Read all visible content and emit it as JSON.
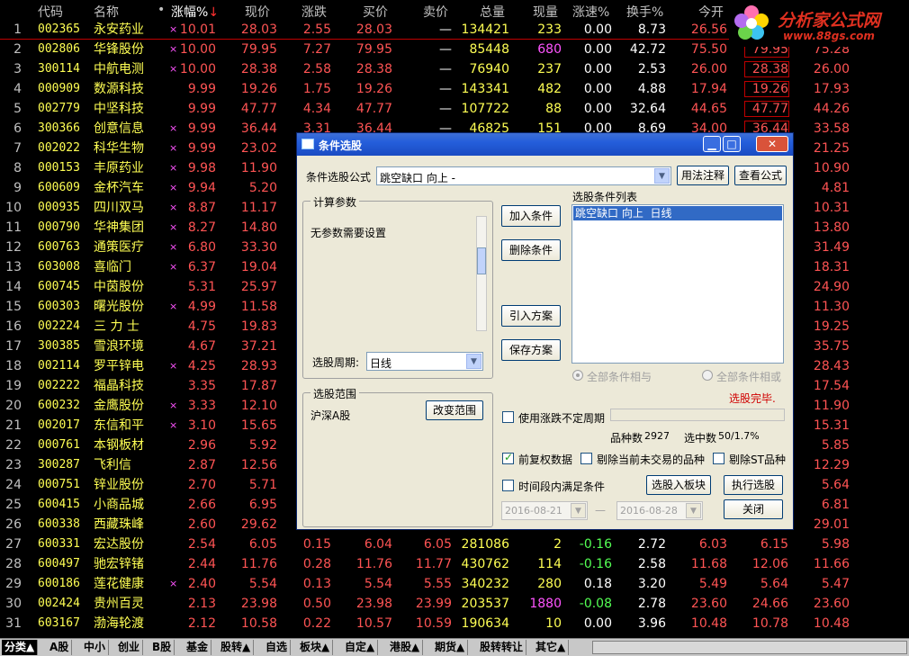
{
  "header": {
    "cols": [
      "代码",
      "名称",
      "•",
      "涨幅%",
      "现价",
      "涨跌",
      "买价",
      "卖价",
      "总量",
      "现量",
      "涨速%",
      "换手%",
      "今开"
    ],
    "sort_indicator": "↓"
  },
  "logo": {
    "title": "分析家公式网",
    "url": "www.88gs.com"
  },
  "rows": [
    {
      "i": "1",
      "code": "002365",
      "name": "永安药业",
      "star": "×",
      "pct": "10.01",
      "price": "28.03",
      "chg": "2.55",
      "buy": "28.03",
      "sell": "—",
      "vol": "134421",
      "cur": "233",
      "spd": "0.00",
      "turn": "8.73",
      "open": "26.56",
      "high": "",
      "low": ""
    },
    {
      "i": "2",
      "code": "002806",
      "name": "华锋股份",
      "star": "×",
      "pct": "10.00",
      "price": "79.95",
      "chg": "7.27",
      "buy": "79.95",
      "sell": "—",
      "vol": "85448",
      "cur": "680",
      "spd": "0.00",
      "turn": "42.72",
      "open": "75.50",
      "high": "79.95",
      "low": "75.28"
    },
    {
      "i": "3",
      "code": "300114",
      "name": "中航电测",
      "star": "×",
      "pct": "10.00",
      "price": "28.38",
      "chg": "2.58",
      "buy": "28.38",
      "sell": "—",
      "vol": "76940",
      "cur": "237",
      "spd": "0.00",
      "turn": "2.53",
      "open": "26.00",
      "high": "28.38",
      "low": "26.00"
    },
    {
      "i": "4",
      "code": "000909",
      "name": "数源科技",
      "star": "",
      "pct": "9.99",
      "price": "19.26",
      "chg": "1.75",
      "buy": "19.26",
      "sell": "—",
      "vol": "143341",
      "cur": "482",
      "spd": "0.00",
      "turn": "4.88",
      "open": "17.94",
      "high": "19.26",
      "low": "17.93"
    },
    {
      "i": "5",
      "code": "002779",
      "name": "中坚科技",
      "star": "",
      "pct": "9.99",
      "price": "47.77",
      "chg": "4.34",
      "buy": "47.77",
      "sell": "—",
      "vol": "107722",
      "cur": "88",
      "spd": "0.00",
      "turn": "32.64",
      "open": "44.65",
      "high": "47.77",
      "low": "44.26"
    },
    {
      "i": "6",
      "code": "300366",
      "name": "创意信息",
      "star": "×",
      "pct": "9.99",
      "price": "36.44",
      "chg": "3.31",
      "buy": "36.44",
      "sell": "—",
      "vol": "46825",
      "cur": "151",
      "spd": "0.00",
      "turn": "8.69",
      "open": "34.00",
      "high": "36.44",
      "low": "33.58"
    },
    {
      "i": "7",
      "code": "002022",
      "name": "科华生物",
      "star": "×",
      "pct": "9.99",
      "price": "23.02",
      "chg": "",
      "buy": "",
      "sell": "",
      "vol": "",
      "cur": "",
      "spd": "",
      "turn": "",
      "open": "",
      "high": "",
      "low": "21.25"
    },
    {
      "i": "8",
      "code": "000153",
      "name": "丰原药业",
      "star": "×",
      "pct": "9.98",
      "price": "11.90",
      "chg": "",
      "buy": "",
      "sell": "",
      "vol": "",
      "cur": "",
      "spd": "",
      "turn": "",
      "open": "",
      "high": "",
      "low": "10.90"
    },
    {
      "i": "9",
      "code": "600609",
      "name": "金杯汽车",
      "star": "×",
      "pct": "9.94",
      "price": "5.20",
      "chg": "",
      "buy": "",
      "sell": "",
      "vol": "",
      "cur": "",
      "spd": "",
      "turn": "",
      "open": "",
      "high": "",
      "low": "4.81"
    },
    {
      "i": "10",
      "code": "000935",
      "name": "四川双马",
      "star": "×",
      "pct": "8.87",
      "price": "11.17",
      "chg": "",
      "buy": "",
      "sell": "",
      "vol": "",
      "cur": "",
      "spd": "",
      "turn": "",
      "open": "",
      "high": "",
      "low": "10.31"
    },
    {
      "i": "11",
      "code": "000790",
      "name": "华神集团",
      "star": "×",
      "pct": "8.27",
      "price": "14.80",
      "chg": "",
      "buy": "",
      "sell": "",
      "vol": "",
      "cur": "",
      "spd": "",
      "turn": "",
      "open": "",
      "high": "",
      "low": "13.80"
    },
    {
      "i": "12",
      "code": "600763",
      "name": "通策医疗",
      "star": "×",
      "pct": "6.80",
      "price": "33.30",
      "chg": "",
      "buy": "",
      "sell": "",
      "vol": "",
      "cur": "",
      "spd": "",
      "turn": "",
      "open": "",
      "high": "",
      "low": "31.49"
    },
    {
      "i": "13",
      "code": "603008",
      "name": "喜临门",
      "star": "×",
      "pct": "6.37",
      "price": "19.04",
      "chg": "",
      "buy": "",
      "sell": "",
      "vol": "",
      "cur": "",
      "spd": "",
      "turn": "",
      "open": "",
      "high": "",
      "low": "18.31"
    },
    {
      "i": "14",
      "code": "600745",
      "name": "中茵股份",
      "star": "",
      "pct": "5.31",
      "price": "25.97",
      "chg": "",
      "buy": "",
      "sell": "",
      "vol": "",
      "cur": "",
      "spd": "",
      "turn": "",
      "open": "",
      "high": "",
      "low": "24.90"
    },
    {
      "i": "15",
      "code": "600303",
      "name": "曙光股份",
      "star": "×",
      "pct": "4.99",
      "price": "11.58",
      "chg": "",
      "buy": "",
      "sell": "",
      "vol": "",
      "cur": "",
      "spd": "",
      "turn": "",
      "open": "",
      "high": "",
      "low": "11.30"
    },
    {
      "i": "16",
      "code": "002224",
      "name": "三 力 士",
      "star": "",
      "pct": "4.75",
      "price": "19.83",
      "chg": "",
      "buy": "",
      "sell": "",
      "vol": "",
      "cur": "",
      "spd": "",
      "turn": "",
      "open": "",
      "high": "",
      "low": "19.25"
    },
    {
      "i": "17",
      "code": "300385",
      "name": "雪浪环境",
      "star": "",
      "pct": "4.67",
      "price": "37.21",
      "chg": "",
      "buy": "",
      "sell": "",
      "vol": "",
      "cur": "",
      "spd": "",
      "turn": "",
      "open": "",
      "high": "",
      "low": "35.75"
    },
    {
      "i": "18",
      "code": "002114",
      "name": "罗平锌电",
      "star": "×",
      "pct": "4.25",
      "price": "28.93",
      "chg": "",
      "buy": "",
      "sell": "",
      "vol": "",
      "cur": "",
      "spd": "",
      "turn": "",
      "open": "",
      "high": "",
      "low": "28.43"
    },
    {
      "i": "19",
      "code": "002222",
      "name": "福晶科技",
      "star": "",
      "pct": "3.35",
      "price": "17.87",
      "chg": "",
      "buy": "",
      "sell": "",
      "vol": "",
      "cur": "",
      "spd": "",
      "turn": "",
      "open": "",
      "high": "",
      "low": "17.54"
    },
    {
      "i": "20",
      "code": "600232",
      "name": "金鹰股份",
      "star": "×",
      "pct": "3.33",
      "price": "12.10",
      "chg": "",
      "buy": "",
      "sell": "",
      "vol": "",
      "cur": "",
      "spd": "",
      "turn": "",
      "open": "",
      "high": "",
      "low": "11.90"
    },
    {
      "i": "21",
      "code": "002017",
      "name": "东信和平",
      "star": "×",
      "pct": "3.10",
      "price": "15.65",
      "chg": "",
      "buy": "",
      "sell": "",
      "vol": "",
      "cur": "",
      "spd": "",
      "turn": "",
      "open": "",
      "high": "",
      "low": "15.31"
    },
    {
      "i": "22",
      "code": "000761",
      "name": "本钢板材",
      "star": "",
      "pct": "2.96",
      "price": "5.92",
      "chg": "",
      "buy": "",
      "sell": "",
      "vol": "",
      "cur": "",
      "spd": "",
      "turn": "",
      "open": "",
      "high": "",
      "low": "5.85"
    },
    {
      "i": "23",
      "code": "300287",
      "name": "飞利信",
      "star": "",
      "pct": "2.87",
      "price": "12.56",
      "chg": "",
      "buy": "",
      "sell": "",
      "vol": "",
      "cur": "",
      "spd": "",
      "turn": "",
      "open": "",
      "high": "",
      "low": "12.29"
    },
    {
      "i": "24",
      "code": "000751",
      "name": "锌业股份",
      "star": "",
      "pct": "2.70",
      "price": "5.71",
      "chg": "",
      "buy": "",
      "sell": "",
      "vol": "",
      "cur": "",
      "spd": "",
      "turn": "",
      "open": "",
      "high": "",
      "low": "5.64"
    },
    {
      "i": "25",
      "code": "600415",
      "name": "小商品城",
      "star": "",
      "pct": "2.66",
      "price": "6.95",
      "chg": "",
      "buy": "",
      "sell": "",
      "vol": "",
      "cur": "",
      "spd": "",
      "turn": "",
      "open": "",
      "high": "",
      "low": "6.81"
    },
    {
      "i": "26",
      "code": "600338",
      "name": "西藏珠峰",
      "star": "",
      "pct": "2.60",
      "price": "29.62",
      "chg": "",
      "buy": "",
      "sell": "",
      "vol": "",
      "cur": "",
      "spd": "",
      "turn": "",
      "open": "",
      "high": "",
      "low": "29.01"
    },
    {
      "i": "27",
      "code": "600331",
      "name": "宏达股份",
      "star": "",
      "pct": "2.54",
      "price": "6.05",
      "chg": "0.15",
      "buy": "6.04",
      "sell": "6.05",
      "vol": "281086",
      "cur": "2",
      "spd": "-0.16",
      "turn": "2.72",
      "open": "6.03",
      "high": "6.15",
      "low": "5.98"
    },
    {
      "i": "28",
      "code": "600497",
      "name": "驰宏锌锗",
      "star": "",
      "pct": "2.44",
      "price": "11.76",
      "chg": "0.28",
      "buy": "11.76",
      "sell": "11.77",
      "vol": "430762",
      "cur": "114",
      "spd": "-0.16",
      "turn": "2.58",
      "open": "11.68",
      "high": "12.06",
      "low": "11.66"
    },
    {
      "i": "29",
      "code": "600186",
      "name": "莲花健康",
      "star": "×",
      "pct": "2.40",
      "price": "5.54",
      "chg": "0.13",
      "buy": "5.54",
      "sell": "5.55",
      "vol": "340232",
      "cur": "280",
      "spd": "0.18",
      "turn": "3.20",
      "open": "5.49",
      "high": "5.64",
      "low": "5.47"
    },
    {
      "i": "30",
      "code": "002424",
      "name": "贵州百灵",
      "star": "",
      "pct": "2.13",
      "price": "23.98",
      "chg": "0.50",
      "buy": "23.98",
      "sell": "23.99",
      "vol": "203537",
      "cur": "1880",
      "spd": "-0.08",
      "turn": "2.78",
      "open": "23.60",
      "high": "24.66",
      "low": "23.60"
    },
    {
      "i": "31",
      "code": "603167",
      "name": "渤海轮渡",
      "star": "",
      "pct": "2.12",
      "price": "10.58",
      "chg": "0.22",
      "buy": "10.57",
      "sell": "10.59",
      "vol": "190634",
      "cur": "10",
      "spd": "0.00",
      "turn": "3.96",
      "open": "10.48",
      "high": "10.78",
      "low": "10.48"
    }
  ],
  "tabs": [
    "分类▲",
    "A股",
    "中小",
    "创业",
    "B股",
    "基金",
    "股转▲",
    "自选",
    "板块▲",
    "自定▲",
    "港股▲",
    "期货▲",
    "股转转让",
    "其它▲"
  ],
  "dialog": {
    "title": "条件选股",
    "formula_label": "条件选股公式",
    "formula_value": "跳空缺口 向上 -",
    "usage_btn": "用法注释",
    "view_btn": "查看公式",
    "params_group": "计算参数",
    "params_text": "无参数需要设置",
    "period_label": "选股周期:",
    "period_value": "日线",
    "range_group": "选股范围",
    "range_value": "沪深A股",
    "change_range_btn": "改变范围",
    "add_cond_btn": "加入条件",
    "del_cond_btn": "删除条件",
    "import_btn": "引入方案",
    "save_btn": "保存方案",
    "cond_list_label": "选股条件列表",
    "cond_items": [
      "跳空缺口 向上  日线"
    ],
    "radio_and": "全部条件相与",
    "radio_or": "全部条件相或",
    "status": "选股完毕.",
    "use_period_chk": "使用涨跌不定周期",
    "count_label": "品种数",
    "count_value": "2927",
    "selected_label": "选中数",
    "selected_value": "50/1.7%",
    "chk_adjust": "前复权数据",
    "chk_exclude_untraded": "剔除当前未交易的品种",
    "chk_exclude_st": "剔除ST品种",
    "chk_time_range": "时间段内满足条件",
    "to_block_btn": "选股入板块",
    "execute_btn": "执行选股",
    "date_from": "2016-08-21",
    "date_to": "2016-08-28",
    "close_btn": "关闭"
  }
}
